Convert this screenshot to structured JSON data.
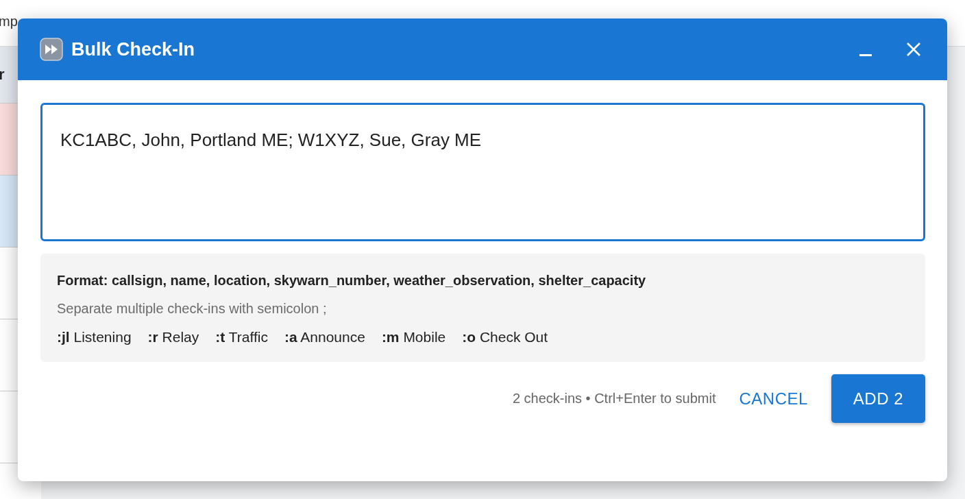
{
  "background": {
    "bookmark_fragment": "mp",
    "column_header_fragment": "r"
  },
  "dialog": {
    "title": "Bulk Check-In",
    "input": {
      "value": "KC1ABC, John, Portland ME; W1XYZ, Sue, Gray ME",
      "focused": true
    },
    "help": {
      "format": "Format: callsign, name, location, skywarn_number, weather_observation, shelter_capacity",
      "hint": "Separate multiple check-ins with semicolon ;",
      "shortcuts": [
        {
          "code": ":jl",
          "label": "Listening"
        },
        {
          "code": ":r",
          "label": "Relay"
        },
        {
          "code": ":t",
          "label": "Traffic"
        },
        {
          "code": ":a",
          "label": "Announce"
        },
        {
          "code": ":m",
          "label": "Mobile"
        },
        {
          "code": ":o",
          "label": "Check Out"
        }
      ]
    },
    "status": "2 check-ins • Ctrl+Enter to submit",
    "buttons": [
      {
        "kind": "text",
        "label": "CANCEL"
      },
      {
        "kind": "primary",
        "label": "ADD 2"
      }
    ]
  }
}
